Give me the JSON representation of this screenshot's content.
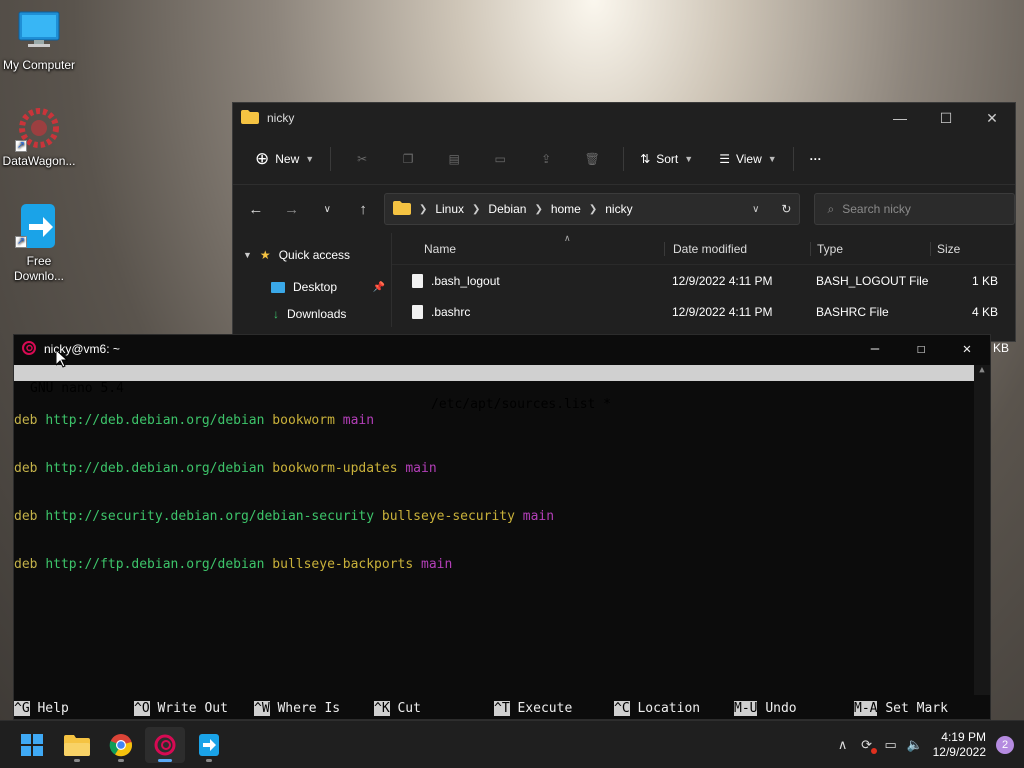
{
  "desktop": {
    "icons": [
      {
        "label": "My Computer"
      },
      {
        "label": "DataWagon..."
      },
      {
        "label": "Free Downlo..."
      }
    ]
  },
  "explorer": {
    "title": "nicky",
    "toolbar": {
      "new_label": "New",
      "sort_label": "Sort",
      "view_label": "View",
      "more_label": "···"
    },
    "breadcrumb": [
      "Linux",
      "Debian",
      "home",
      "nicky"
    ],
    "search_placeholder": "Search nicky",
    "nav": {
      "quick_access": "Quick access",
      "desktop": "Desktop",
      "downloads": "Downloads"
    },
    "columns": {
      "name": "Name",
      "date": "Date modified",
      "type": "Type",
      "size": "Size"
    },
    "files": [
      {
        "name": ".bash_logout",
        "date": "12/9/2022 4:11 PM",
        "type": "BASH_LOGOUT File",
        "size": "1 KB"
      },
      {
        "name": ".bashrc",
        "date": "12/9/2022 4:11 PM",
        "type": "BASHRC File",
        "size": "4 KB"
      }
    ],
    "partial_size": "KB"
  },
  "terminal": {
    "title": "nicky@vm6: ~",
    "nano_version": "GNU nano 5.4",
    "filename": "/etc/apt/sources.list *",
    "lines": [
      {
        "kw": "deb",
        "url": "http://deb.debian.org/debian",
        "suite": "bookworm",
        "comp": "main"
      },
      {
        "kw": "deb",
        "url": "http://deb.debian.org/debian",
        "suite": "bookworm-updates",
        "comp": "main"
      },
      {
        "kw": "deb",
        "url": "http://security.debian.org/debian-security",
        "suite": "bullseye-security",
        "comp": "main"
      },
      {
        "kw": "deb",
        "url": "http://ftp.debian.org/debian",
        "suite": "bullseye-backports",
        "comp": "main"
      }
    ],
    "shortcuts": [
      {
        "key": "^G",
        "label": "Help"
      },
      {
        "key": "^O",
        "label": "Write Out"
      },
      {
        "key": "^W",
        "label": "Where Is"
      },
      {
        "key": "^K",
        "label": "Cut"
      },
      {
        "key": "^T",
        "label": "Execute"
      },
      {
        "key": "^C",
        "label": "Location"
      },
      {
        "key": "M-U",
        "label": "Undo"
      },
      {
        "key": "M-A",
        "label": "Set Mark"
      }
    ]
  },
  "taskbar": {
    "time": "4:19 PM",
    "date": "12/9/2022",
    "notification_count": "2"
  },
  "colors": {
    "terminal_bg": "#0c0c0c",
    "url_green": "#3dc46a",
    "component_magenta": "#b33fb8",
    "explorer_bg": "#202020"
  }
}
